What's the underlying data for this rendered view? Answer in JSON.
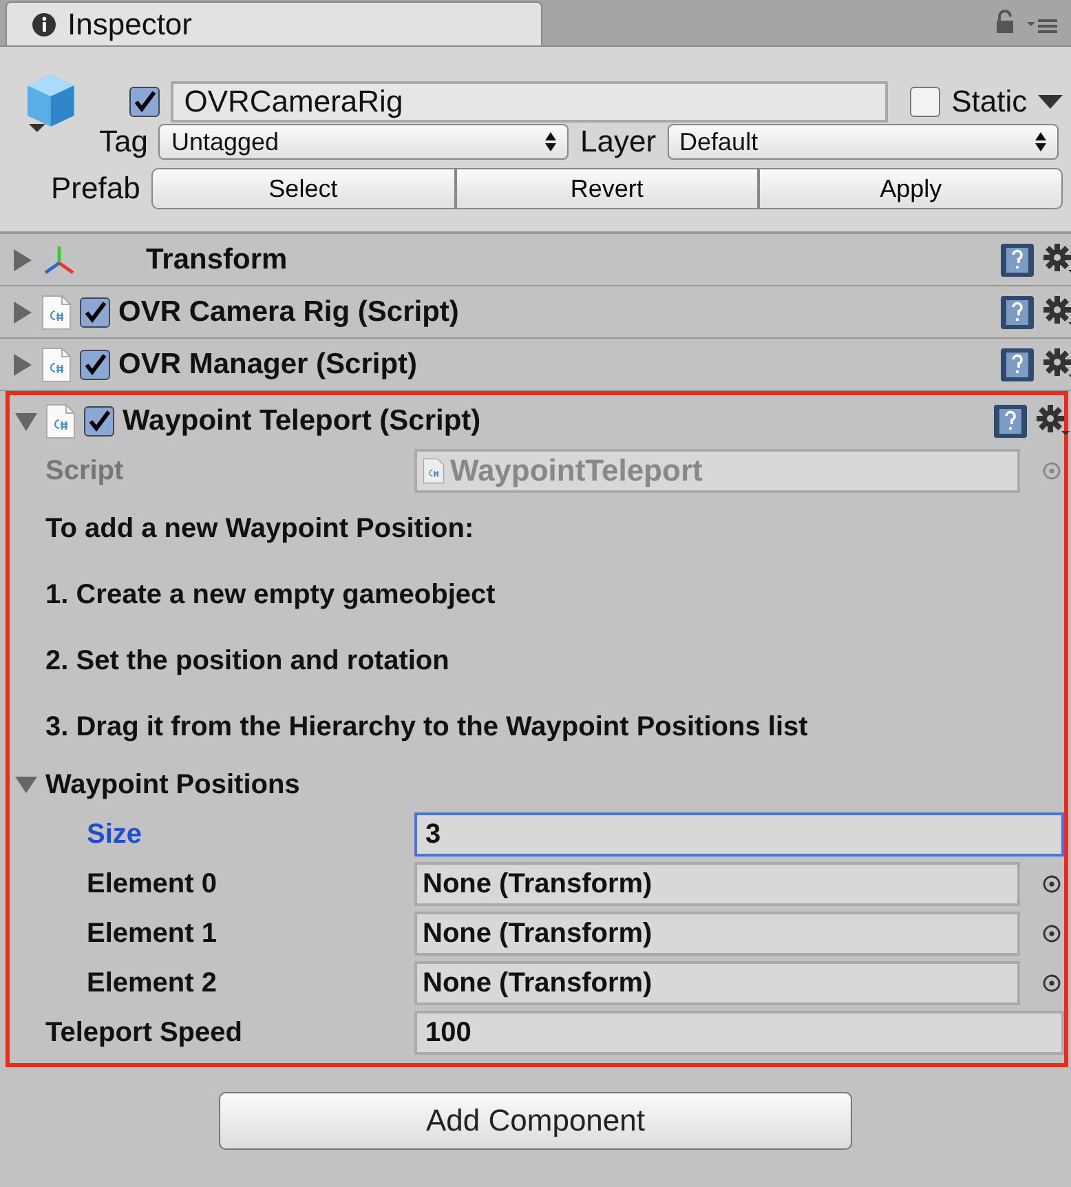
{
  "tab": {
    "title": "Inspector"
  },
  "object": {
    "active": true,
    "name": "OVRCameraRig",
    "static": false,
    "static_label": "Static",
    "tag_label": "Tag",
    "tag": "Untagged",
    "layer_label": "Layer",
    "layer": "Default",
    "prefab_label": "Prefab",
    "prefab_buttons": [
      "Select",
      "Revert",
      "Apply"
    ]
  },
  "components": [
    {
      "kind": "transform",
      "title": "Transform",
      "expanded": false,
      "highlighted": false
    },
    {
      "kind": "script",
      "title": "OVR Camera Rig (Script)",
      "enabled": true,
      "expanded": false,
      "highlighted": false
    },
    {
      "kind": "script",
      "title": "OVR Manager (Script)",
      "enabled": true,
      "expanded": false,
      "highlighted": false
    },
    {
      "kind": "script",
      "title": "Waypoint Teleport (Script)",
      "enabled": true,
      "expanded": true,
      "highlighted": true
    }
  ],
  "body": {
    "script_label": "Script",
    "script_value": "WaypointTeleport",
    "help_lines": [
      "To add a new Waypoint Position:",
      "1. Create a new empty gameobject",
      "2. Set the position and rotation",
      "3. Drag it from the Hierarchy to the Waypoint Positions list"
    ],
    "list": {
      "label": "Waypoint Positions",
      "expanded": true,
      "size_label": "Size",
      "size": "3",
      "size_focused": true,
      "elements": [
        {
          "label": "Element 0",
          "value": "None (Transform)"
        },
        {
          "label": "Element 1",
          "value": "None (Transform)"
        },
        {
          "label": "Element 2",
          "value": "None (Transform)"
        }
      ]
    },
    "speed_label": "Teleport Speed",
    "speed": "100"
  },
  "add_button": "Add Component"
}
